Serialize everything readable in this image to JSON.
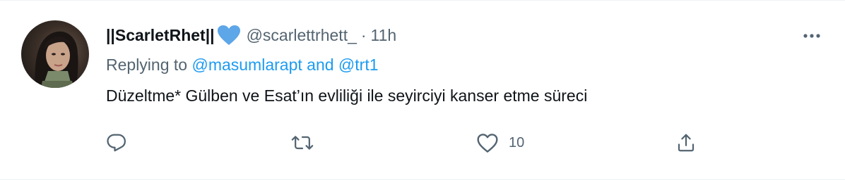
{
  "tweet": {
    "display_name": "||ScarletRhet||",
    "verified_emoji": "blue-heart",
    "handle": "@scarlettrhett_",
    "separator": "·",
    "time": "11h",
    "replying_prefix": "Replying to",
    "reply_targets": [
      "@masumlarapt",
      "@trt1"
    ],
    "reply_conjunction": "and",
    "text": "Düzeltme* Gülben ve Esat’ın evliliği ile seyirciyi kanser etme süreci",
    "actions": {
      "reply_count": "",
      "retweet_count": "",
      "like_count": "10",
      "share_count": ""
    }
  },
  "colors": {
    "link": "#1d9bf0",
    "secondary_text": "#536471",
    "primary_text": "#0f1419",
    "heart": "#5da6e8"
  },
  "icons": {
    "more": "more-horizontal-icon",
    "reply": "reply-icon",
    "retweet": "retweet-icon",
    "like": "like-heart-icon",
    "share": "share-icon"
  }
}
